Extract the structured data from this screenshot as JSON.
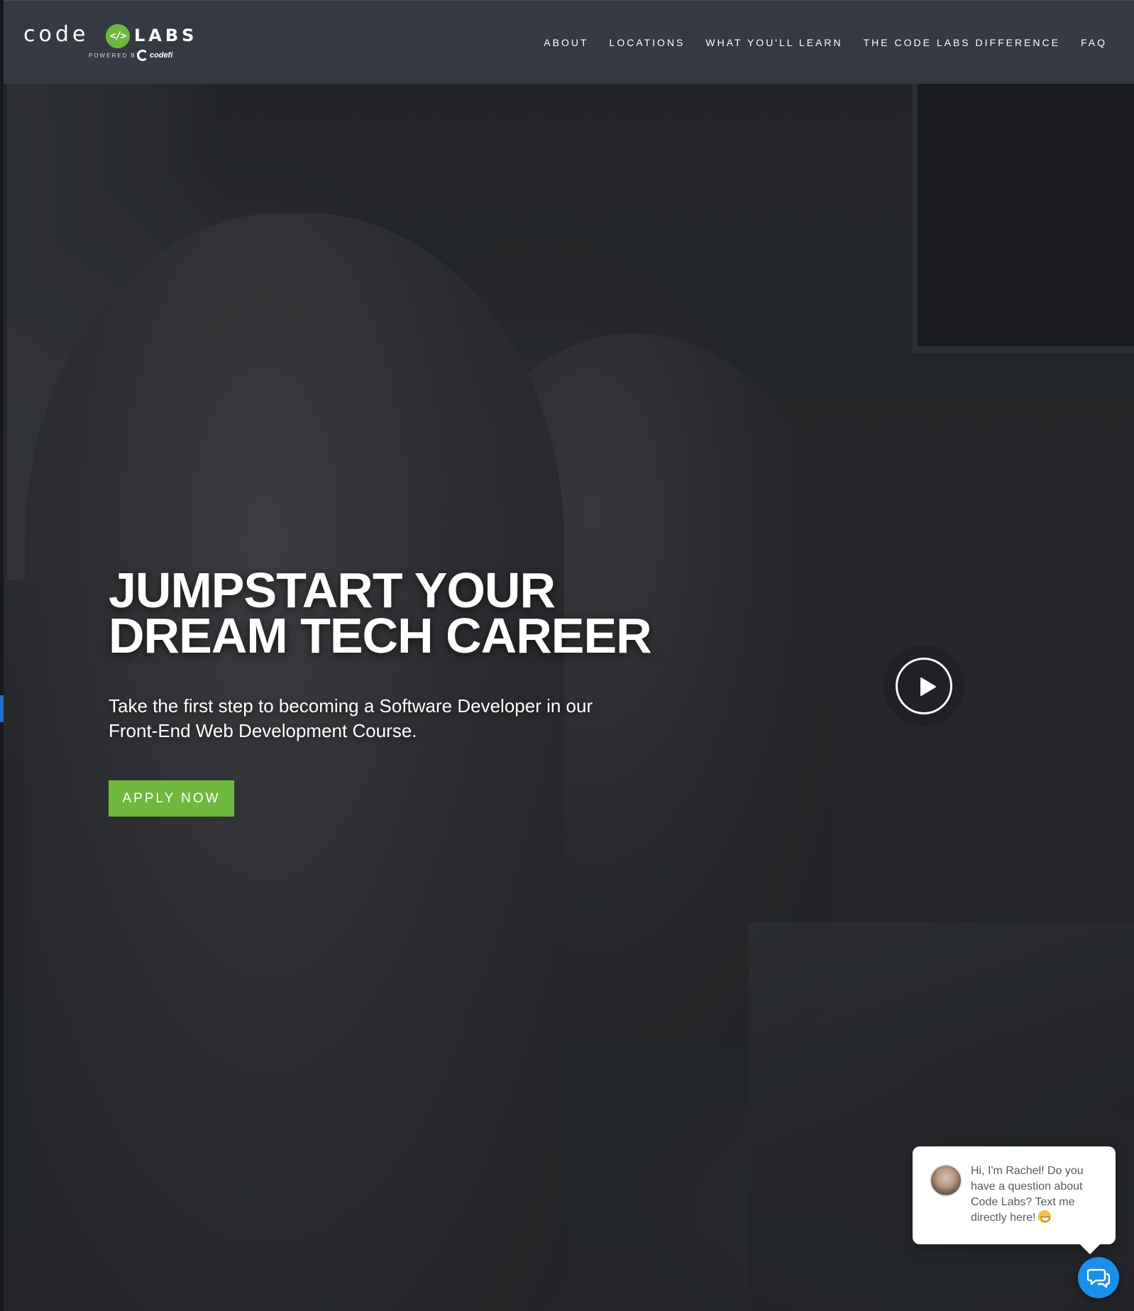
{
  "header": {
    "logo": {
      "code_text": "code",
      "mark_text": "</>",
      "labs_text": "LABS",
      "powered_by": "POWERED BY",
      "codefi_text": "codefi"
    },
    "nav": [
      {
        "label": "ABOUT"
      },
      {
        "label": "LOCATIONS"
      },
      {
        "label": "WHAT YOU'LL LEARN"
      },
      {
        "label": "THE CODE LABS DIFFERENCE"
      },
      {
        "label": "FAQ"
      }
    ]
  },
  "hero": {
    "title_line1": "JUMPSTART YOUR",
    "title_line2": "DREAM TECH CAREER",
    "subtitle_line1": "Take the first step to becoming a Software Developer in our",
    "subtitle_line2": "Front-End Web Development Course.",
    "cta_label": "APPLY NOW",
    "play_icon": "play-icon"
  },
  "chat": {
    "message": "Hi, I'm Rachel! Do you have a question about Code Labs? Text me directly here!",
    "emoji_icon": "grinning-face-icon",
    "launcher_icon": "chat-bubbles-icon"
  },
  "colors": {
    "header_bg": "#353a42",
    "accent_green": "#6fb83f",
    "chat_blue": "#1a8fe8",
    "text_white": "#ffffff"
  }
}
